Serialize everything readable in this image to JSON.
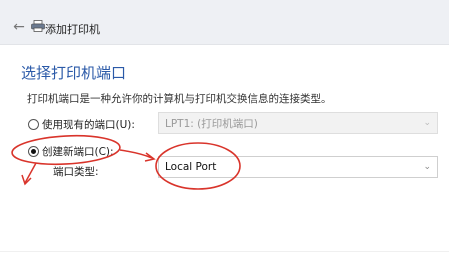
{
  "window": {
    "title": "添加打印机",
    "back_glyph": "←"
  },
  "page": {
    "heading": "选择打印机端口",
    "description": "打印机端口是一种允许你的计算机与打印机交换信息的连接类型。"
  },
  "existing_port": {
    "label": "使用现有的端口(U):",
    "selected_value": "LPT1: (打印机端口)",
    "checked": false,
    "enabled": false
  },
  "new_port": {
    "label": "创建新端口(C):",
    "checked": true,
    "type_label": "端口类型:",
    "type_value": "Local Port"
  },
  "colors": {
    "heading": "#2b5aa8",
    "annotation": "#d9342b"
  }
}
